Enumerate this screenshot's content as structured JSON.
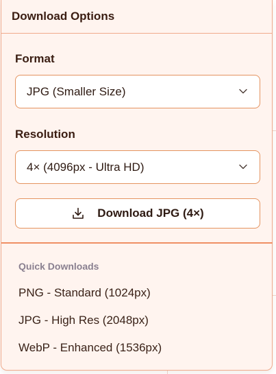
{
  "panel": {
    "title": "Download Options"
  },
  "format": {
    "label": "Format",
    "selected": "JPG (Smaller Size)"
  },
  "resolution": {
    "label": "Resolution",
    "selected": "4× (4096px - Ultra HD)"
  },
  "download_button": {
    "label": "Download JPG (4×)",
    "icon": "download-icon"
  },
  "quick_downloads": {
    "heading": "Quick Downloads",
    "items": [
      "PNG - Standard (1024px)",
      "JPG - High Res (2048px)",
      "WebP - Enhanced (1536px)"
    ]
  },
  "colors": {
    "panel_background": "#fff4ef",
    "accent_border": "#e4935f",
    "divider": "#f0a98b",
    "heading_muted": "#8a8090",
    "text_dark": "#3a1d12"
  }
}
